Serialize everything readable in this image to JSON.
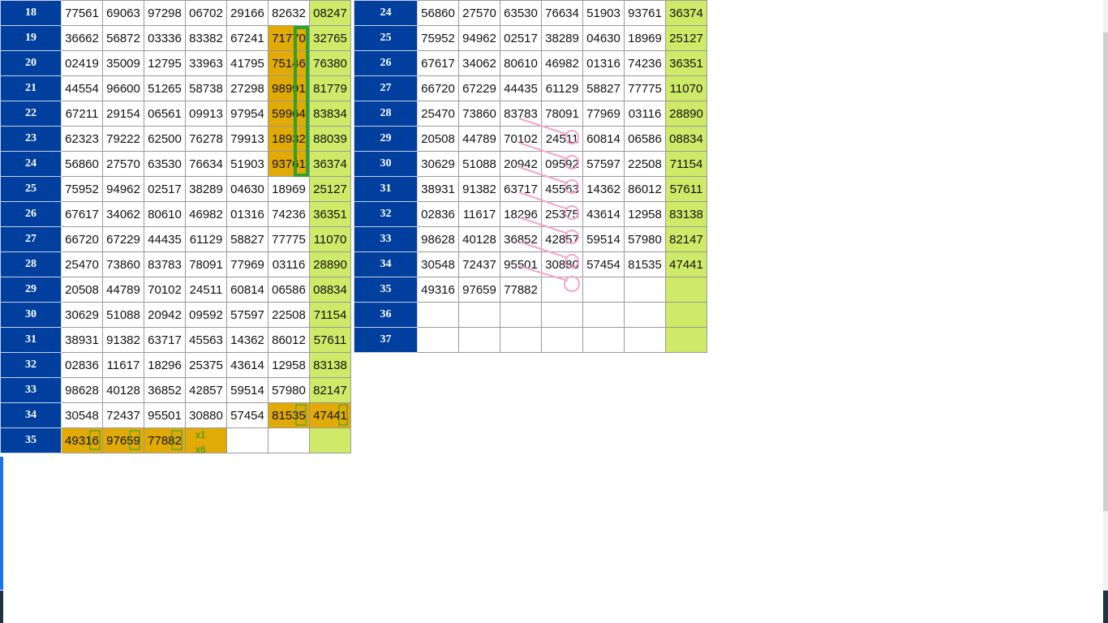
{
  "left_table": {
    "rows": [
      {
        "num": "18",
        "cells": [
          "77561",
          "69063",
          "97298",
          "06702",
          "29166",
          "82632",
          "08247"
        ]
      },
      {
        "num": "19",
        "cells": [
          "36662",
          "56872",
          "03336",
          "83382",
          "67241",
          "71770",
          "32765"
        ]
      },
      {
        "num": "20",
        "cells": [
          "02419",
          "35009",
          "12795",
          "33963",
          "41795",
          "75146",
          "76380"
        ]
      },
      {
        "num": "21",
        "cells": [
          "44554",
          "96600",
          "51265",
          "58738",
          "27298",
          "98991",
          "81779"
        ]
      },
      {
        "num": "22",
        "cells": [
          "67211",
          "29154",
          "06561",
          "09913",
          "97954",
          "59964",
          "83834"
        ]
      },
      {
        "num": "23",
        "cells": [
          "62323",
          "79222",
          "62500",
          "76278",
          "79913",
          "18932",
          "88039"
        ]
      },
      {
        "num": "24",
        "cells": [
          "56860",
          "27570",
          "63530",
          "76634",
          "51903",
          "93761",
          "36374"
        ]
      },
      {
        "num": "25",
        "cells": [
          "75952",
          "94962",
          "02517",
          "38289",
          "04630",
          "18969",
          "25127"
        ]
      },
      {
        "num": "26",
        "cells": [
          "67617",
          "34062",
          "80610",
          "46982",
          "01316",
          "74236",
          "36351"
        ]
      },
      {
        "num": "27",
        "cells": [
          "66720",
          "67229",
          "44435",
          "61129",
          "58827",
          "77775",
          "11070"
        ]
      },
      {
        "num": "28",
        "cells": [
          "25470",
          "73860",
          "83783",
          "78091",
          "77969",
          "03116",
          "28890"
        ]
      },
      {
        "num": "29",
        "cells": [
          "20508",
          "44789",
          "70102",
          "24511",
          "60814",
          "06586",
          "08834"
        ]
      },
      {
        "num": "30",
        "cells": [
          "30629",
          "51088",
          "20942",
          "09592",
          "57597",
          "22508",
          "71154"
        ]
      },
      {
        "num": "31",
        "cells": [
          "38931",
          "91382",
          "63717",
          "45563",
          "14362",
          "86012",
          "57611"
        ]
      },
      {
        "num": "32",
        "cells": [
          "02836",
          "11617",
          "18296",
          "25375",
          "43614",
          "12958",
          "83138"
        ]
      },
      {
        "num": "33",
        "cells": [
          "98628",
          "40128",
          "36852",
          "42857",
          "59514",
          "57980",
          "82147"
        ]
      },
      {
        "num": "34",
        "cells": [
          "30548",
          "72437",
          "95501",
          "30880",
          "57454",
          "81535",
          "47441"
        ]
      },
      {
        "num": "35",
        "cells": [
          "49316",
          "97659",
          "77882",
          "",
          "",
          "",
          ""
        ]
      }
    ]
  },
  "right_table": {
    "rows": [
      {
        "num": "24",
        "cells": [
          "56860",
          "27570",
          "63530",
          "76634",
          "51903",
          "93761",
          "36374"
        ]
      },
      {
        "num": "25",
        "cells": [
          "75952",
          "94962",
          "02517",
          "38289",
          "04630",
          "18969",
          "25127"
        ]
      },
      {
        "num": "26",
        "cells": [
          "67617",
          "34062",
          "80610",
          "46982",
          "01316",
          "74236",
          "36351"
        ]
      },
      {
        "num": "27",
        "cells": [
          "66720",
          "67229",
          "44435",
          "61129",
          "58827",
          "77775",
          "11070"
        ]
      },
      {
        "num": "28",
        "cells": [
          "25470",
          "73860",
          "83783",
          "78091",
          "77969",
          "03116",
          "28890"
        ]
      },
      {
        "num": "29",
        "cells": [
          "20508",
          "44789",
          "70102",
          "24511",
          "60814",
          "06586",
          "08834"
        ]
      },
      {
        "num": "30",
        "cells": [
          "30629",
          "51088",
          "20942",
          "09592",
          "57597",
          "22508",
          "71154"
        ]
      },
      {
        "num": "31",
        "cells": [
          "38931",
          "91382",
          "63717",
          "45563",
          "14362",
          "86012",
          "57611"
        ]
      },
      {
        "num": "32",
        "cells": [
          "02836",
          "11617",
          "18296",
          "25375",
          "43614",
          "12958",
          "83138"
        ]
      },
      {
        "num": "33",
        "cells": [
          "98628",
          "40128",
          "36852",
          "42857",
          "59514",
          "57980",
          "82147"
        ]
      },
      {
        "num": "34",
        "cells": [
          "30548",
          "72437",
          "95501",
          "30880",
          "57454",
          "81535",
          "47441"
        ]
      },
      {
        "num": "35",
        "cells": [
          "49316",
          "97659",
          "77882",
          "",
          "",
          "",
          ""
        ]
      },
      {
        "num": "36",
        "cells": [
          "",
          "",
          "",
          "",
          "",
          "",
          ""
        ]
      },
      {
        "num": "37",
        "cells": [
          "",
          "",
          "",
          "",
          "",
          "",
          ""
        ]
      }
    ]
  },
  "annotations": {
    "x1_label": "x1",
    "x6_label": "x6"
  },
  "colors": {
    "row_number_bg": "#003f9e",
    "last_column_bg": "#cfe968",
    "highlight_bg": "#e2aa06",
    "green_marker": "#2aa32a",
    "pink_marker": "#f4a6c8"
  }
}
